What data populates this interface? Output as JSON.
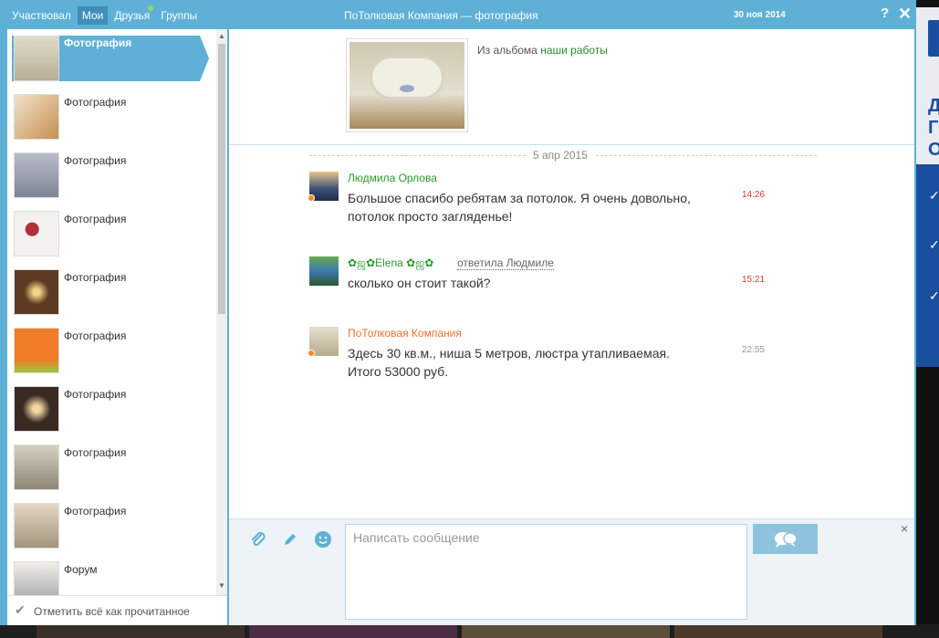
{
  "header": {
    "tabs": [
      {
        "label": "Участвовал",
        "active": false
      },
      {
        "label": "Мои",
        "active": true
      },
      {
        "label": "Друзья",
        "active": false,
        "online_dot": true
      },
      {
        "label": "Группы",
        "active": false
      }
    ],
    "title": "ПоТолковая Компания — фотография",
    "date": "30 ноя 2014",
    "help_label": "?",
    "close_label": "✕"
  },
  "sidebar": {
    "items": [
      {
        "label": "Фотография",
        "active": true
      },
      {
        "label": "Фотография"
      },
      {
        "label": "Фотография"
      },
      {
        "label": "Фотография"
      },
      {
        "label": "Фотография"
      },
      {
        "label": "Фотография"
      },
      {
        "label": "Фотография"
      },
      {
        "label": "Фотография"
      },
      {
        "label": "Фотография"
      },
      {
        "label": "Форум"
      }
    ],
    "mark_all_read": "Отметить всё как прочитанное"
  },
  "album": {
    "source_prefix": "Из альбома",
    "album_link": "наши работы"
  },
  "thread": {
    "date": "5 апр 2015",
    "messages": [
      {
        "author": "Людмила Орлова",
        "text": "Большое спасибо ребятам за потолок. Я очень довольно, потолок просто загляденье!",
        "time": "14:26"
      },
      {
        "author": "✿ஜ✿Elena ✿ஜ✿",
        "reply_to": "ответила Людмиле",
        "text": "сколько он стоит такой?",
        "time": "15:21"
      },
      {
        "author": "ПоТолковая Компания",
        "text": "Здесь 30 кв.м., ниша 5 метров, люстра утапливаемая. Итого 53000 руб.",
        "time": "22:55"
      }
    ]
  },
  "compose": {
    "placeholder": "Написать сообщение",
    "close_label": "×"
  },
  "background_ad": {
    "text": "Д\nГ\nО"
  },
  "colors": {
    "accent": "#5eb0d6",
    "author_green": "#2a9a2a",
    "author_orange": "#eb722e",
    "time_red": "#e23636"
  }
}
